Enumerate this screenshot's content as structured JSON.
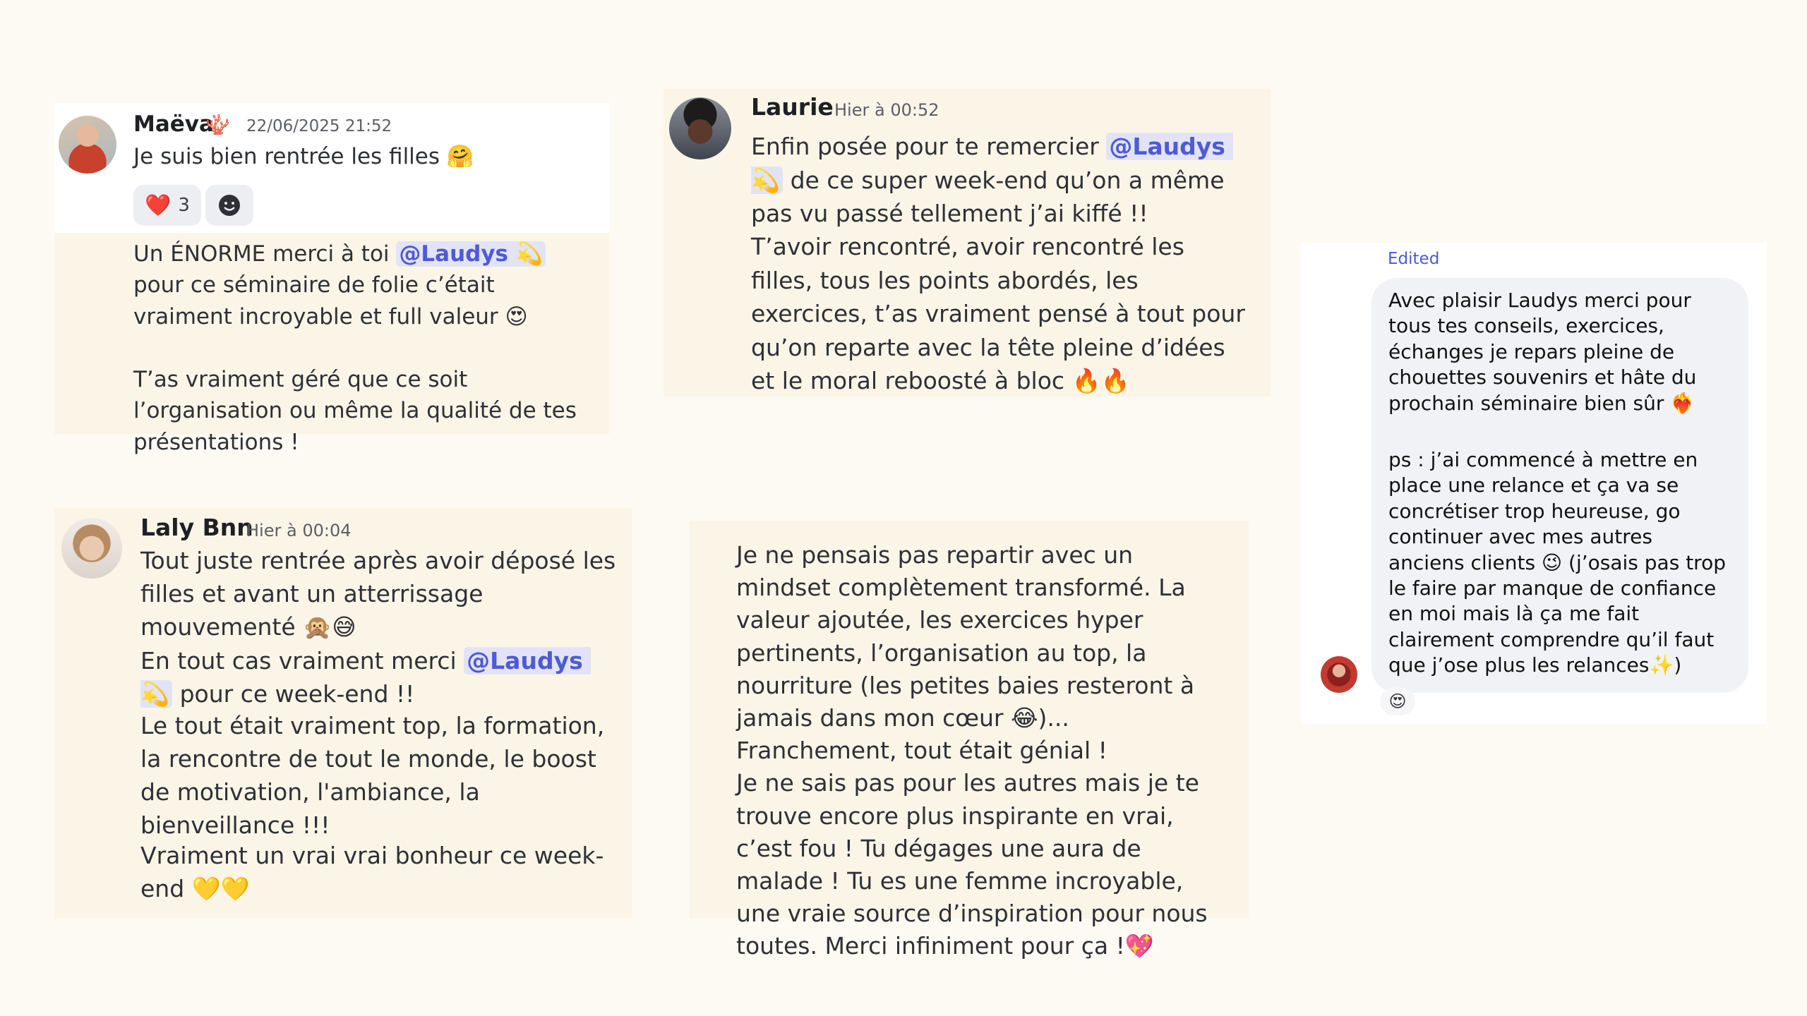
{
  "maeva": {
    "name": "Maëva",
    "badge": "🪸",
    "timestamp": "22/06/2025 21:52",
    "line1": "Je suis bien rentrée les filles 🤗",
    "reaction_emoji": "❤️",
    "reaction_count": "3",
    "add_reaction_icon": "smiley-add-icon",
    "msg2_part1": "Un ÉNORME merci à toi ",
    "mention": "@Laudys 💫",
    "msg2_part2": " pour ce séminaire de folie c’était vraiment incroyable et full valeur 😍",
    "msg3": "T’as vraiment géré que ce soit l’organisation ou même la qualité de tes présentations !"
  },
  "laurie": {
    "name": "Laurie",
    "timestamp": "Hier à 00:52",
    "part1": "Enfin posée pour te remercier ",
    "mention": "@Laudys 💫",
    "part2": " de ce super week-end qu’on a même pas vu passé tellement j’ai kiffé !!",
    "part3": "T’avoir rencontré, avoir rencontré les filles, tous les points abordés, les exercices, t’as vraiment pensé à tout pour qu’on reparte avec la tête pleine d’idées et le moral reboosté à bloc 🔥🔥"
  },
  "laly": {
    "name": "Laly Bnn",
    "timestamp": "Hier à 00:04",
    "line1": "Tout juste rentrée après avoir déposé les filles et avant un atterrissage mouvementé 🙊😅",
    "part1": "En tout cas vraiment merci ",
    "mention": "@Laudys 💫",
    "part2": " pour ce week-end !!",
    "part3": "Le tout était vraiment top, la formation, la rencontre de tout le monde, le boost de motivation, l'ambiance, la bienveillance !!!",
    "part4": "Vraiment un vrai vrai bonheur ce week-end 💛💛"
  },
  "anon": {
    "text": "Je ne pensais pas repartir avec un mindset complètement transformé. La valeur ajoutée, les exercices hyper pertinents, l’organisation au top, la nourriture (les petites baies resteront à jamais dans mon cœur 😂)...\nFranchement, tout était génial !\nJe ne sais pas pour les autres mais je te trouve encore plus inspirante en vrai, c’est fou ! Tu dégages une aura de malade ! Tu es une femme incroyable, une vraie source d’inspiration pour nous toutes. Merci infiniment pour ça !💖"
  },
  "insta": {
    "edited_label": "Edited",
    "para1": "Avec plaisir Laudys merci pour tous tes conseils, exercices, échanges je repars pleine de chouettes souvenirs et hâte du prochain séminaire bien sûr ❤️‍🔥",
    "para2": "ps : j’ai commencé à mettre en place une relance et ça va se concrétiser trop heureuse, go continuer avec mes autres anciens clients 😉 (j’osais pas trop le faire par manque de confiance en moi mais là ça me fait clairement comprendre qu’il faut que j’ose plus les relances✨)",
    "reaction": "😍"
  },
  "colors": {
    "background": "#fdfaf3",
    "card": "#fbf5e8",
    "mention_bg": "#e2e3f7",
    "mention_text": "#4e5ad6",
    "edited": "#4b5bd6"
  }
}
